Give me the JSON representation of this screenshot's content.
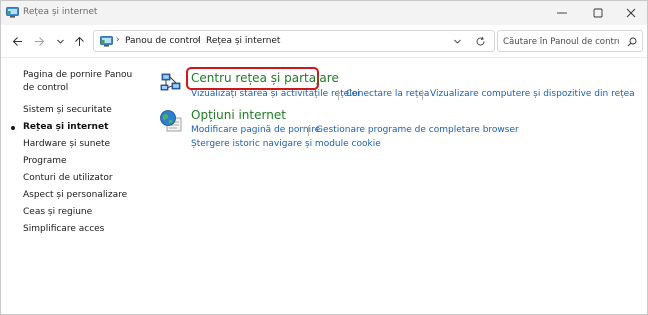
{
  "window": {
    "title": "Rețea și internet"
  },
  "navigation": {
    "breadcrumbs": [
      "Panou de control",
      "Rețea și internet"
    ],
    "search_placeholder": "Căutare în Panoul de control"
  },
  "sidebar": {
    "home": "Pagina de pornire Panou de control",
    "items": [
      {
        "label": "Sistem și securitate",
        "active": false
      },
      {
        "label": "Rețea și internet",
        "active": true
      },
      {
        "label": "Hardware și sunete",
        "active": false
      },
      {
        "label": "Programe",
        "active": false
      },
      {
        "label": "Conturi de utilizator",
        "active": false
      },
      {
        "label": "Aspect și personalizare",
        "active": false
      },
      {
        "label": "Ceas și regiune",
        "active": false
      },
      {
        "label": "Simplificare acces",
        "active": false
      }
    ]
  },
  "categories": [
    {
      "title": "Centru rețea și partajare",
      "highlighted": true,
      "tasks": [
        "Vizualizați starea și activitățile rețelei",
        "Conectare la rețea",
        "Vizualizare computere și dispozitive din rețea"
      ]
    },
    {
      "title": "Opțiuni internet",
      "highlighted": false,
      "tasks": [
        "Modificare pagină de pornire",
        "Gestionare programe de completare browser",
        "Ștergere istoric navigare și module cookie"
      ]
    }
  ],
  "colors": {
    "category_title": "#207a24",
    "task_link": "#1a5fb4",
    "highlight_border": "#d3151a"
  }
}
